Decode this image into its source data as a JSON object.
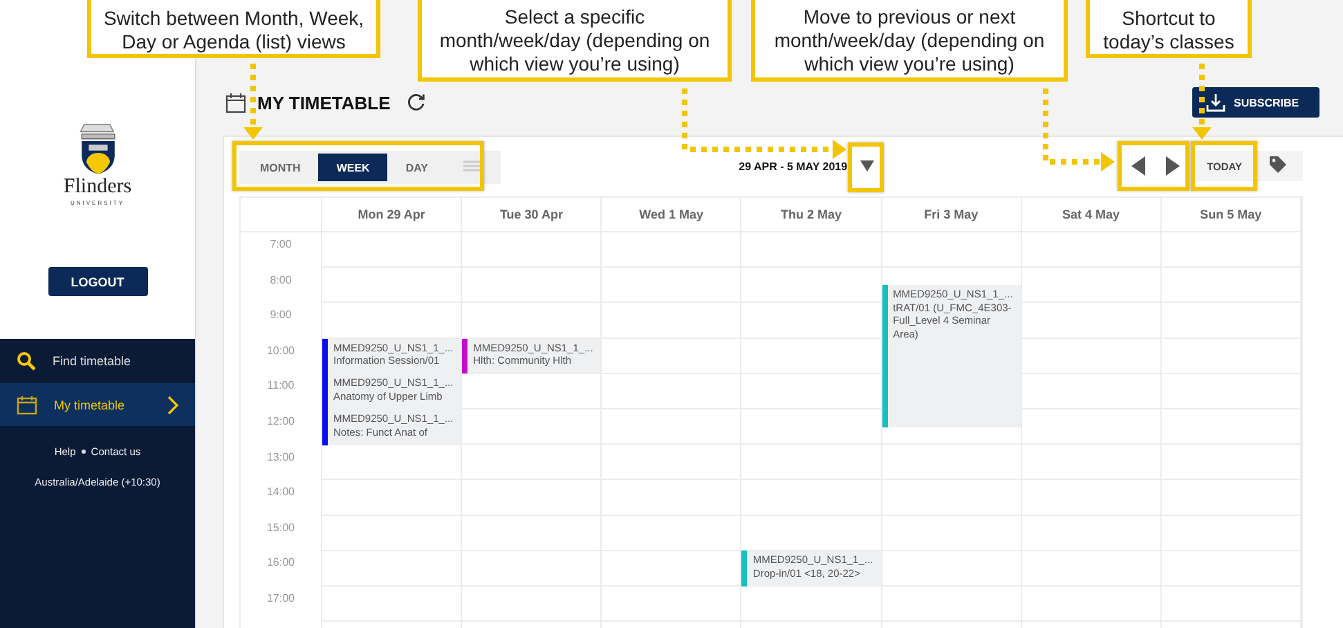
{
  "sidebar": {
    "logo": {
      "name": "Flinders",
      "subtitle": "UNIVERSITY"
    },
    "logout": "LOGOUT",
    "nav": [
      {
        "label": "Find timetable",
        "selected": false
      },
      {
        "label": "My timetable",
        "selected": true
      }
    ],
    "links": [
      "Help",
      "Contact us"
    ],
    "timezone": "Australia/Adelaide (+10:30)"
  },
  "header": {
    "title": "MY TIMETABLE",
    "subscribe": "SUBSCRIBE"
  },
  "toolbar": {
    "views": [
      {
        "label": "MONTH",
        "kind": "text",
        "selected": false
      },
      {
        "label": "WEEK",
        "kind": "text",
        "selected": true
      },
      {
        "label": "DAY",
        "kind": "text",
        "selected": false
      },
      {
        "kind": "list",
        "selected": false
      }
    ],
    "date_range": "29 APR - 5 MAY 2019",
    "today": "TODAY"
  },
  "calendar": {
    "days": [
      "Mon 29 Apr",
      "Tue 30 Apr",
      "Wed 1 May",
      "Thu 2 May",
      "Fri 3 May",
      "Sat 4 May",
      "Sun 5 May"
    ],
    "hours": [
      {
        "label": "7:00"
      },
      {
        "label": "8:00",
        "events": [
          {
            "kind": "fri",
            "long": true,
            "half_start": true,
            "code": "MMED9250_U_NS1_1_...",
            "text": "tRAT/01 (U_FMC_4E303-Full_Level 4 Seminar Area)",
            "color": "#14c0c0"
          }
        ]
      },
      {
        "label": "9:00"
      },
      {
        "label": "10:00",
        "events": [
          {
            "kind": "mon",
            "long": false,
            "half_start": false,
            "code": "MMED9250_U_NS1_1_...",
            "text": "Information Session/01",
            "color": "#0a0ff0"
          },
          {
            "kind": "tue",
            "long": false,
            "half_start": false,
            "code": "MMED9250_U_NS1_1_...",
            "text": "Hlth: Community Hlth",
            "color": "#c010c8"
          }
        ]
      },
      {
        "label": "11:00",
        "events": [
          {
            "kind": "mon",
            "long": false,
            "half_start": false,
            "code": "MMED9250_U_NS1_1_...",
            "text": "Anatomy of Upper Limb",
            "color": "#0a0ff0"
          }
        ]
      },
      {
        "label": "12:00",
        "events": [
          {
            "kind": "mon",
            "long": false,
            "half_start": false,
            "code": "MMED9250_U_NS1_1_...",
            "text": "Notes: Funct Anat of",
            "color": "#0a0ff0"
          }
        ]
      },
      {
        "label": "13:00"
      },
      {
        "label": "14:00"
      },
      {
        "label": "15:00"
      },
      {
        "label": "16:00",
        "events": [
          {
            "kind": "thu",
            "long": false,
            "half_start": false,
            "code": "MMED9250_U_NS1_1_...",
            "text": "Drop-in/01 <18, 20-22>",
            "color": "#14c0c0"
          }
        ]
      },
      {
        "label": "17:00"
      }
    ]
  },
  "callouts": [
    "Switch between Month, Week, Day or Agenda (list) views",
    "Select a specific month/week/day (depending on which view you’re using)",
    "Move to previous or next month/week/day (depending on which view you’re using)",
    "Shortcut to today’s classes"
  ]
}
